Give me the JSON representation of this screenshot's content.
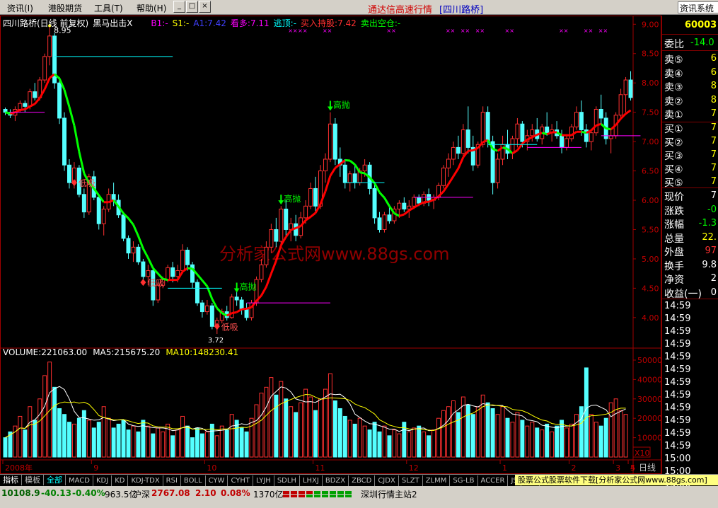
{
  "menubar": {
    "items": [
      "资讯(I)",
      "港股期货",
      "工具(T)",
      "帮助(H)"
    ],
    "title": "通达信高速行情",
    "title2": "[四川路桥]",
    "right_button": "资讯系统"
  },
  "chart_header": {
    "stock_name": "四川路桥(日线 前复权)",
    "indicator_name": "黑马出击X",
    "b1": "B1:-",
    "s1": "S1:-",
    "a1": "A1:7.42",
    "kanduo": "看多:7.11",
    "taoding": "逃顶:-",
    "buy_hold": "买入持股:7.42",
    "sell_empty": "卖出空仓:-"
  },
  "volume_header": {
    "volume": "VOLUME:221063.00",
    "ma5": "MA5:215675.20",
    "ma10": "MA10:148230.41"
  },
  "annotations": {
    "high_peak": "8.95",
    "low_suck": "低吸",
    "high_throw": "高抛",
    "low_marker": "3.72",
    "watermark": "分析家公式网www.88gs.com"
  },
  "price_axis": [
    "9.00",
    "8.50",
    "8.00",
    "7.50",
    "7.00",
    "6.50",
    "6.00",
    "5.50",
    "5.00",
    "4.50",
    "4.00"
  ],
  "volume_axis": [
    "50000",
    "40000",
    "30000",
    "20000",
    "10000"
  ],
  "volume_unit": "X10",
  "date_axis": [
    "2008年",
    "9",
    "10",
    "11",
    "12",
    "1",
    "2",
    "3",
    "4",
    "5"
  ],
  "period_label": "日线",
  "tabs": [
    "指标",
    "模板",
    "全部",
    "MACD",
    "KDJ",
    "KD",
    "KDJ-TDX",
    "RSI",
    "BOLL",
    "CYW",
    "CYHT",
    "LYJH",
    "SDLH",
    "LHXJ",
    "BDZX",
    "ZBCD",
    "CJDX",
    "SLZT",
    "ZLMM",
    "SG-LB",
    "ACCER",
    "JS",
    "MFI"
  ],
  "ad_text": "股票公式股票软件下载[分析家公式网www.88gs.com]",
  "status": {
    "index_value": "10108.9",
    "index_change": "-40.13",
    "index_pct": "-0.40%",
    "amount1": "963.5亿",
    "sh_label": "沪深",
    "sh_value": "2767.08",
    "sh_change": "2.10",
    "sh_pct": "0.08%",
    "amount2": "1370亿",
    "station": "深圳行情主站2"
  },
  "right_panel": {
    "code": "60003",
    "weibi_label": "委比",
    "weibi_value": "-14.0",
    "sells": [
      {
        "label": "卖⑤",
        "value": "6"
      },
      {
        "label": "卖④",
        "value": "6"
      },
      {
        "label": "卖③",
        "value": "8"
      },
      {
        "label": "卖②",
        "value": "8"
      },
      {
        "label": "卖①",
        "value": "7"
      }
    ],
    "buys": [
      {
        "label": "买①",
        "value": "7"
      },
      {
        "label": "买②",
        "value": "7"
      },
      {
        "label": "买③",
        "value": "7"
      },
      {
        "label": "买④",
        "value": "7"
      },
      {
        "label": "买⑤",
        "value": "7"
      }
    ],
    "stats": [
      {
        "label": "现价",
        "value": "7",
        "color": "#ffffff"
      },
      {
        "label": "涨跌",
        "value": "-0",
        "color": "#00ff00"
      },
      {
        "label": "涨幅",
        "value": "-1.3",
        "color": "#00ff00"
      },
      {
        "label": "总量",
        "value": "22.",
        "color": "#ffff00"
      },
      {
        "label": "外盘",
        "value": "97",
        "color": "#ff3030"
      },
      {
        "label": "换手",
        "value": "9.8",
        "color": "#ffffff"
      },
      {
        "label": "净资",
        "value": "2",
        "color": "#ffffff"
      },
      {
        "label": "收益(一)",
        "value": "0",
        "color": "#ffffff"
      }
    ],
    "times": [
      "14:59",
      "14:59",
      "14:59",
      "14:59",
      "14:59",
      "14:59",
      "14:59",
      "14:59",
      "14:59",
      "14:59",
      "14:59",
      "14:59",
      "15:00",
      "15:00",
      "15:00"
    ]
  },
  "chart_data": {
    "type": "candlestick",
    "ylim": [
      3.6,
      9.1
    ],
    "candles": [
      [
        7.55,
        7.58,
        7.45,
        7.5
      ],
      [
        7.5,
        7.55,
        7.4,
        7.45
      ],
      [
        7.45,
        7.6,
        7.35,
        7.55
      ],
      [
        7.55,
        7.7,
        7.5,
        7.65
      ],
      [
        7.65,
        7.7,
        7.5,
        7.6
      ],
      [
        7.6,
        7.9,
        7.55,
        7.85
      ],
      [
        7.85,
        8.0,
        7.7,
        7.75
      ],
      [
        7.75,
        8.1,
        7.7,
        8.05
      ],
      [
        8.05,
        8.5,
        8.0,
        8.45
      ],
      [
        8.45,
        8.95,
        8.3,
        8.8
      ],
      [
        8.8,
        8.85,
        7.9,
        8.0
      ],
      [
        8.0,
        8.1,
        7.3,
        7.4
      ],
      [
        7.4,
        7.5,
        6.5,
        6.6
      ],
      [
        6.6,
        6.7,
        6.2,
        6.3
      ],
      [
        6.3,
        6.65,
        6.2,
        6.55
      ],
      [
        6.55,
        6.6,
        6.05,
        6.1
      ],
      [
        6.1,
        6.2,
        5.7,
        5.8
      ],
      [
        5.8,
        6.45,
        5.75,
        6.4
      ],
      [
        6.4,
        6.5,
        6.0,
        6.05
      ],
      [
        6.05,
        6.1,
        5.5,
        5.6
      ],
      [
        5.6,
        5.9,
        5.4,
        5.85
      ],
      [
        5.85,
        6.2,
        5.8,
        6.1
      ],
      [
        6.1,
        6.3,
        5.9,
        6.0
      ],
      [
        6.0,
        6.1,
        5.7,
        5.75
      ],
      [
        5.75,
        5.8,
        5.3,
        5.35
      ],
      [
        5.35,
        5.4,
        5.0,
        5.1
      ],
      [
        5.1,
        5.3,
        4.95,
        5.2
      ],
      [
        5.2,
        5.25,
        4.9,
        4.95
      ],
      [
        4.95,
        5.0,
        4.6,
        4.7
      ],
      [
        4.7,
        4.9,
        4.55,
        4.8
      ],
      [
        4.8,
        4.85,
        4.2,
        4.3
      ],
      [
        4.3,
        4.6,
        4.25,
        4.55
      ],
      [
        4.55,
        4.7,
        4.5,
        4.65
      ],
      [
        4.65,
        4.9,
        4.6,
        4.85
      ],
      [
        4.85,
        4.95,
        4.6,
        4.7
      ],
      [
        4.7,
        4.9,
        4.6,
        4.8
      ],
      [
        4.8,
        5.25,
        4.75,
        5.15
      ],
      [
        5.15,
        5.2,
        4.8,
        4.9
      ],
      [
        4.9,
        4.95,
        4.5,
        4.6
      ],
      [
        4.6,
        4.65,
        4.2,
        4.25
      ],
      [
        4.25,
        4.3,
        4.0,
        4.1
      ],
      [
        4.1,
        4.3,
        4.05,
        4.2
      ],
      [
        4.2,
        4.25,
        3.8,
        3.85
      ],
      [
        3.85,
        4.0,
        3.72,
        3.95
      ],
      [
        3.95,
        4.15,
        3.9,
        4.1
      ],
      [
        4.1,
        4.2,
        3.95,
        4.0
      ],
      [
        4.0,
        4.4,
        3.98,
        4.35
      ],
      [
        4.35,
        4.5,
        4.2,
        4.3
      ],
      [
        4.3,
        4.35,
        4.05,
        4.15
      ],
      [
        4.15,
        4.25,
        3.95,
        4.0
      ],
      [
        4.0,
        4.3,
        3.95,
        4.25
      ],
      [
        4.25,
        4.7,
        4.2,
        4.65
      ],
      [
        4.65,
        5.0,
        4.6,
        4.9
      ],
      [
        4.9,
        5.3,
        4.85,
        5.2
      ],
      [
        5.2,
        5.6,
        5.1,
        5.5
      ],
      [
        5.5,
        5.7,
        5.2,
        5.3
      ],
      [
        5.3,
        5.9,
        5.25,
        5.85
      ],
      [
        5.85,
        6.0,
        5.4,
        5.5
      ],
      [
        5.5,
        5.7,
        5.3,
        5.6
      ],
      [
        5.6,
        5.75,
        5.3,
        5.4
      ],
      [
        5.4,
        5.8,
        5.35,
        5.7
      ],
      [
        5.7,
        6.0,
        5.6,
        5.9
      ],
      [
        5.9,
        6.3,
        5.85,
        6.2
      ],
      [
        6.2,
        6.4,
        5.8,
        5.9
      ],
      [
        5.9,
        6.6,
        5.85,
        6.5
      ],
      [
        6.5,
        6.8,
        6.3,
        6.7
      ],
      [
        6.7,
        7.5,
        6.65,
        7.3
      ],
      [
        7.3,
        7.4,
        6.6,
        6.7
      ],
      [
        6.7,
        6.9,
        6.4,
        6.6
      ],
      [
        6.6,
        6.7,
        6.2,
        6.3
      ],
      [
        6.3,
        6.5,
        6.15,
        6.45
      ],
      [
        6.45,
        6.6,
        6.2,
        6.3
      ],
      [
        6.3,
        6.55,
        6.25,
        6.5
      ],
      [
        6.5,
        6.7,
        6.4,
        6.6
      ],
      [
        6.6,
        6.65,
        6.1,
        6.2
      ],
      [
        6.2,
        6.3,
        5.6,
        5.7
      ],
      [
        5.7,
        5.8,
        5.45,
        5.5
      ],
      [
        5.5,
        5.8,
        5.45,
        5.75
      ],
      [
        5.75,
        5.9,
        5.6,
        5.65
      ],
      [
        5.65,
        5.9,
        5.6,
        5.85
      ],
      [
        5.85,
        6.0,
        5.7,
        5.95
      ],
      [
        5.95,
        6.05,
        5.8,
        5.85
      ],
      [
        5.85,
        6.0,
        5.7,
        5.9
      ],
      [
        5.9,
        6.1,
        5.85,
        6.05
      ],
      [
        6.05,
        6.1,
        5.9,
        5.95
      ],
      [
        5.95,
        6.15,
        5.9,
        6.1
      ],
      [
        6.1,
        6.2,
        5.9,
        6.0
      ],
      [
        6.0,
        6.1,
        5.85,
        6.05
      ],
      [
        6.05,
        6.3,
        6.0,
        6.25
      ],
      [
        6.25,
        6.6,
        6.2,
        6.55
      ],
      [
        6.55,
        6.8,
        6.4,
        6.7
      ],
      [
        6.7,
        7.0,
        6.6,
        6.9
      ],
      [
        6.9,
        7.1,
        6.7,
        6.8
      ],
      [
        6.8,
        7.3,
        6.75,
        7.2
      ],
      [
        7.2,
        7.6,
        6.8,
        6.9
      ],
      [
        6.9,
        7.1,
        6.5,
        6.6
      ],
      [
        6.6,
        7.0,
        6.55,
        6.95
      ],
      [
        6.95,
        7.6,
        6.9,
        7.5
      ],
      [
        7.5,
        7.6,
        6.9,
        7.0
      ],
      [
        7.0,
        7.1,
        6.1,
        6.3
      ],
      [
        6.3,
        6.8,
        6.2,
        6.7
      ],
      [
        6.7,
        7.1,
        6.6,
        6.95
      ],
      [
        6.95,
        7.2,
        6.7,
        6.8
      ],
      [
        6.8,
        7.1,
        6.7,
        7.05
      ],
      [
        7.05,
        7.4,
        6.9,
        7.3
      ],
      [
        7.3,
        7.35,
        6.9,
        7.0
      ],
      [
        7.0,
        7.2,
        6.85,
        7.1
      ],
      [
        7.1,
        7.3,
        7.0,
        7.2
      ],
      [
        7.2,
        7.4,
        7.0,
        7.05
      ],
      [
        7.05,
        7.3,
        6.95,
        7.25
      ],
      [
        7.25,
        7.5,
        7.1,
        7.15
      ],
      [
        7.15,
        7.3,
        7.0,
        7.2
      ],
      [
        7.2,
        7.35,
        7.05,
        7.1
      ],
      [
        7.1,
        7.2,
        6.8,
        6.9
      ],
      [
        6.9,
        7.1,
        6.85,
        7.05
      ],
      [
        7.05,
        7.3,
        7.0,
        7.25
      ],
      [
        7.25,
        7.6,
        7.2,
        7.5
      ],
      [
        7.5,
        7.7,
        7.1,
        7.2
      ],
      [
        7.2,
        7.3,
        6.9,
        7.0
      ],
      [
        7.0,
        7.2,
        6.85,
        7.15
      ],
      [
        7.15,
        7.6,
        7.1,
        7.55
      ],
      [
        7.55,
        7.8,
        7.3,
        7.4
      ],
      [
        7.4,
        7.5,
        6.95,
        7.05
      ],
      [
        7.05,
        7.2,
        6.8,
        7.1
      ],
      [
        7.1,
        7.5,
        7.05,
        7.45
      ],
      [
        7.45,
        7.9,
        7.4,
        7.8
      ],
      [
        7.8,
        8.1,
        7.5,
        8.05
      ],
      [
        8.05,
        8.2,
        7.7,
        7.75
      ]
    ],
    "volumes": [
      1.0,
      1.3,
      1.6,
      2.1,
      1.4,
      2.6,
      1.9,
      3.0,
      4.2,
      4.9,
      3.6,
      2.5,
      2.2,
      1.8,
      1.7,
      2.0,
      2.4,
      1.9,
      1.5,
      1.8,
      2.6,
      2.0,
      1.5,
      1.7,
      1.9,
      1.4,
      1.6,
      1.3,
      1.9,
      1.6,
      1.2,
      1.5,
      1.3,
      1.7,
      1.1,
      1.4,
      2.1,
      1.6,
      1.0,
      1.5,
      1.2,
      1.3,
      1.7,
      1.1,
      1.6,
      1.4,
      2.2,
      1.9,
      1.5,
      1.3,
      2.0,
      2.7,
      3.3,
      3.6,
      4.1,
      3.2,
      3.9,
      3.0,
      2.6,
      2.3,
      2.8,
      3.5,
      3.1,
      2.4,
      3.0,
      3.5,
      4.3,
      2.9,
      2.5,
      2.1,
      1.9,
      1.7,
      2.0,
      1.6,
      1.4,
      1.8,
      1.3,
      1.6,
      1.1,
      1.4,
      1.2,
      1.8,
      1.3,
      1.5,
      1.6,
      1.3,
      1.1,
      1.4,
      2.0,
      2.4,
      2.6,
      2.9,
      2.3,
      3.1,
      2.7,
      2.2,
      2.6,
      3.2,
      2.8,
      2.5,
      2.2,
      2.6,
      2.0,
      1.8,
      2.3,
      1.9,
      1.6,
      1.8,
      1.5,
      1.4,
      1.7,
      1.3,
      1.6,
      1.9,
      1.5,
      1.7,
      2.2,
      2.6,
      4.6,
      2.2,
      1.8,
      1.6,
      2.0,
      2.8,
      3.0,
      2.4,
      2.2
    ]
  }
}
